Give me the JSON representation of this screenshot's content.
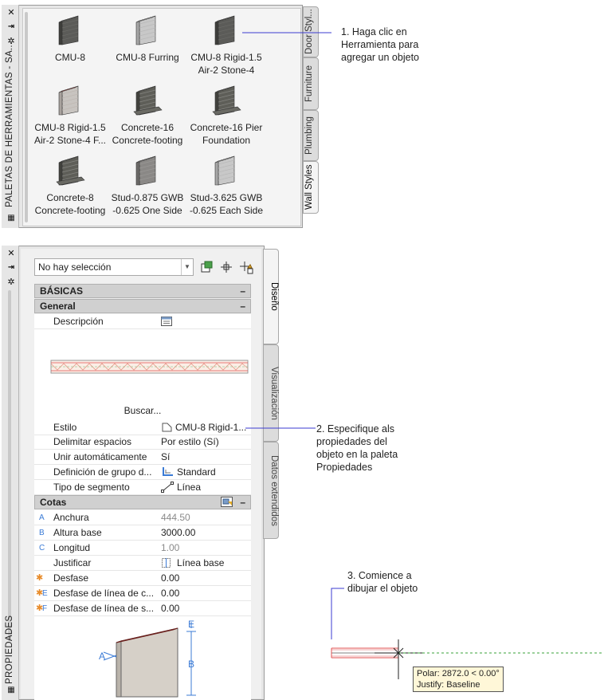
{
  "tool_palette": {
    "title": "PALETAS DE HERRAMIENTAS - SA...",
    "tabs": [
      "Door Styl...",
      "Furniture",
      "Plumbing",
      "Wall Styles"
    ],
    "active_tab": "Wall Styles",
    "tools": [
      {
        "line1": "CMU-8",
        "line2": "",
        "icon": "dark-wall-icon"
      },
      {
        "line1": "CMU-8 Furring",
        "line2": "",
        "icon": "light-wall-icon"
      },
      {
        "line1": "CMU-8 Rigid-1.5",
        "line2": "Air-2 Stone-4",
        "icon": "dark-wall-icon"
      },
      {
        "line1": "CMU-8 Rigid-1.5",
        "line2": "Air-2 Stone-4 F...",
        "icon": "brick-wall-icon"
      },
      {
        "line1": "Concrete-16",
        "line2": "Concrete-footing",
        "icon": "footing-wall-icon"
      },
      {
        "line1": "Concrete-16 Pier",
        "line2": "Foundation",
        "icon": "footing-wall-icon"
      },
      {
        "line1": "Concrete-8",
        "line2": "Concrete-footing",
        "icon": "footing-wall-icon"
      },
      {
        "line1": "Stud-0.875 GWB",
        "line2": "-0.625 One Side",
        "icon": "stud-wall-icon"
      },
      {
        "line1": "Stud-3.625 GWB",
        "line2": "-0.625 Each Side",
        "icon": "light-wall-icon"
      }
    ]
  },
  "properties": {
    "title": "PROPIEDADES",
    "selection": "No hay selección",
    "tabs": [
      "Diseño",
      "Visualización",
      "Datos extendidos"
    ],
    "active_tab": "Diseño",
    "section_basic": "BÁSICAS",
    "section_general": "General",
    "collapse": "–",
    "description_label": "Descripción",
    "search_label": "Buscar...",
    "general_rows": [
      {
        "label": "Estilo",
        "value": "CMU-8 Rigid-1..."
      },
      {
        "label": "Delimitar espacios",
        "value": "Por estilo (Sí)"
      },
      {
        "label": "Unir automáticamente",
        "value": "Sí"
      },
      {
        "label": "Definición de grupo d...",
        "value": "Standard"
      },
      {
        "label": "Tipo de segmento",
        "value": "Línea"
      }
    ],
    "section_dims": "Cotas",
    "dim_rows": [
      {
        "key": "A",
        "label": "Anchura",
        "value": "444.50",
        "disabled": true
      },
      {
        "key": "B",
        "label": "Altura base",
        "value": "3000.00",
        "disabled": false
      },
      {
        "key": "C",
        "label": "Longitud",
        "value": "1.00",
        "disabled": true
      },
      {
        "key": "",
        "label": "Justificar",
        "value": "Línea base",
        "disabled": false
      },
      {
        "key": "",
        "label": "Desfase",
        "value": "0.00",
        "disabled": false
      },
      {
        "key": "E",
        "label": "Desfase de línea de c...",
        "value": "0.00",
        "disabled": false
      },
      {
        "key": "F",
        "label": "Desfase de línea de s...",
        "value": "0.00",
        "disabled": false
      }
    ],
    "diagram_labels": {
      "a": "A",
      "b": "B",
      "e": "E"
    }
  },
  "callouts": {
    "step1": [
      "1. Haga clic en",
      "Herramienta para",
      "agregar un objeto"
    ],
    "step2": [
      "2. Especifique als",
      "propiedades del",
      "objeto en la paleta",
      "Propiedades"
    ],
    "step3": [
      "3. Comience a",
      "dibujar el objeto"
    ]
  },
  "tooltip": {
    "polar": "Polar: 2872.0 < 0.00°",
    "justify": "Justify: Baseline"
  },
  "colors": {
    "callout_line": "#3b3bd0",
    "wall_red": "#e05050",
    "tracking_green": "#3aa03a",
    "tooltip_bg": "#fff7d8"
  }
}
